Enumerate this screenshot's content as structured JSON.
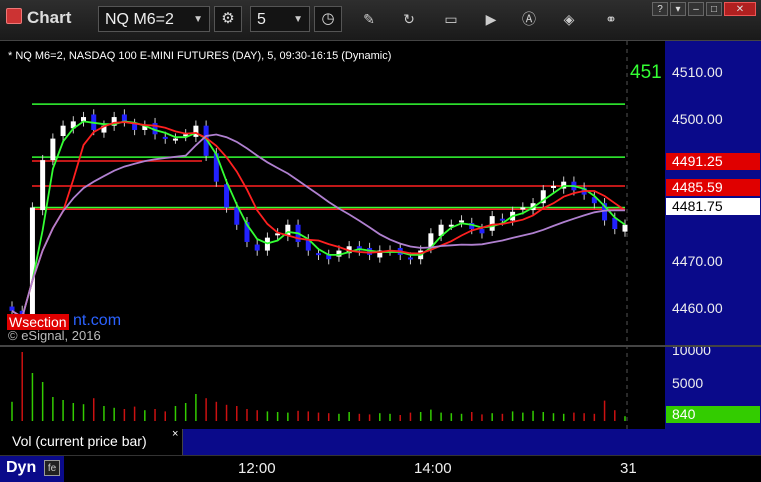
{
  "window": {
    "title": "Chart"
  },
  "toolbar": {
    "symbol": "NQ M6=2",
    "interval": "5"
  },
  "chart": {
    "description": "* NQ M6=2, NASDAQ 100 E-MINI FUTURES (DAY), 5, 09:30-16:15 (Dynamic)",
    "hline_label": "451",
    "price_axis": [
      "4510.00",
      "4500.00",
      "4470.00",
      "4460.00"
    ],
    "price_tags": [
      {
        "text": "4491.25",
        "bg": "#e00000",
        "fg": "#ffffff"
      },
      {
        "text": "4485.59",
        "bg": "#e00000",
        "fg": "#ffffff"
      },
      {
        "text": "4481.75",
        "bg": "#ffffff",
        "fg": "#000000"
      }
    ],
    "copyright": "© eSignal, 2016",
    "watermark_badge": "Wsection",
    "watermark_url": "nt.com"
  },
  "volume": {
    "axis": [
      "10000",
      "5000"
    ],
    "tag": "840",
    "tag_color": "#33cc00"
  },
  "study": {
    "label": "Vol (current price bar)",
    "close": "×"
  },
  "timebar": {
    "mode": "Dyn",
    "labels": [
      "12:00",
      "14:00",
      "31"
    ]
  },
  "colors": {
    "up_candle": "#ffffff",
    "down_candle": "#2222ff",
    "ma_fast": "#33ff33",
    "ma_red": "#ff2020",
    "ma_purple": "#b080d0",
    "level_line": "#33ff33",
    "vol_up": "#33cc00",
    "vol_down": "#cc1111"
  },
  "chart_data": {
    "type": "candlestick",
    "price_range": [
      4455,
      4517
    ],
    "levels": [
      {
        "price": 4510.0,
        "color": "#33ff33"
      },
      {
        "price": 4497.7,
        "color": "#33ff33"
      },
      {
        "price": 4486.0,
        "color": "#33ff33"
      },
      {
        "price": 4496.8,
        "color": "#ff2020",
        "until": 0.31
      },
      {
        "price": 4491.0,
        "color": "#ff2020"
      },
      {
        "price": 4485.6,
        "color": "#ff2020"
      }
    ],
    "closes": [
      4462,
      4459,
      4486,
      4497,
      4502,
      4505,
      4506,
      4507,
      4504,
      4505,
      4507,
      4506,
      4504,
      4505,
      4503,
      4502,
      4502,
      4503,
      4505,
      4498,
      4492,
      4486,
      4482,
      4478,
      4476,
      4479,
      4480,
      4482,
      4478,
      4476,
      4475,
      4474,
      4476,
      4477,
      4476,
      4475,
      4476,
      4476,
      4475,
      4474,
      4476,
      4480,
      4482,
      4482,
      4483,
      4481,
      4480,
      4484,
      4483,
      4485,
      4486,
      4487,
      4490,
      4491,
      4492,
      4490,
      4489,
      4487,
      4483,
      4481,
      4482
    ],
    "volumes_k": [
      3.2,
      11.5,
      8.0,
      6.5,
      4.0,
      3.5,
      3.0,
      2.8,
      3.8,
      2.5,
      2.2,
      2.0,
      2.4,
      1.8,
      2.0,
      1.6,
      2.5,
      3.0,
      4.5,
      3.8,
      3.2,
      2.7,
      2.5,
      2.0,
      1.8,
      1.6,
      1.5,
      1.4,
      1.7,
      1.6,
      1.4,
      1.3,
      1.2,
      1.5,
      1.2,
      1.1,
      1.3,
      1.2,
      1.0,
      1.4,
      1.5,
      1.9,
      1.4,
      1.3,
      1.2,
      1.5,
      1.1,
      1.3,
      1.2,
      1.6,
      1.4,
      1.7,
      1.5,
      1.3,
      1.2,
      1.4,
      1.3,
      1.2,
      3.4,
      1.8,
      0.8
    ]
  }
}
